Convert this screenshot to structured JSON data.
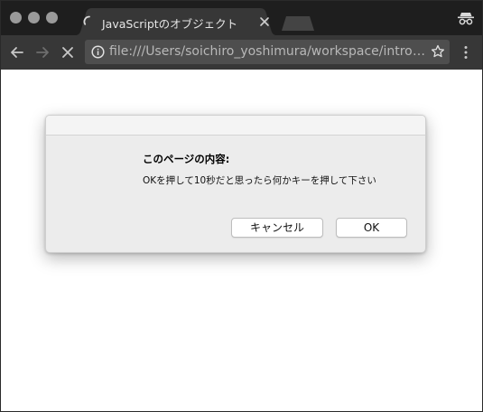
{
  "browser": {
    "tab": {
      "title": "JavaScriptのオブジェクト",
      "loading": true
    },
    "address_bar": {
      "url": "file:///Users/soichiro_yoshimura/workspace/intro-sa..."
    }
  },
  "dialog": {
    "title": "このページの内容:",
    "message": "OKを押して10秒だと思ったら何かキーを押して下さい",
    "cancel_label": "キャンセル",
    "ok_label": "OK"
  },
  "colors": {
    "tabstrip_bg": "#1e1e1e",
    "active_tab_bg": "#373737",
    "toolbar_bg": "#373737",
    "omnibox_bg": "#4e4e4e",
    "dialog_bg": "#ececec"
  },
  "icons": {
    "tab_spinner": "loading-spinner-icon",
    "tab_close": "close-icon",
    "incognito": "incognito-icon",
    "back": "back-arrow-icon",
    "forward": "forward-arrow-icon",
    "stop": "stop-icon",
    "info": "info-icon",
    "bookmark": "star-icon",
    "menu": "kebab-menu-icon"
  }
}
